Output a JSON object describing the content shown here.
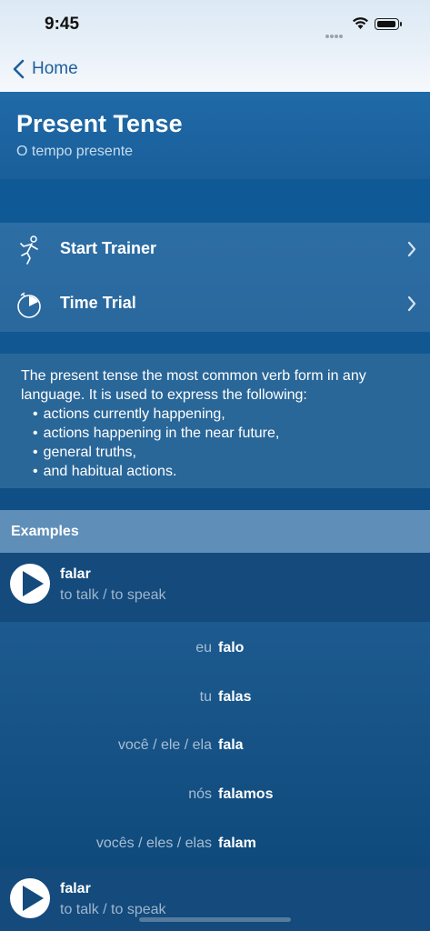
{
  "status": {
    "time": "9:45"
  },
  "nav": {
    "back_label": "Home"
  },
  "header": {
    "title": "Present Tense",
    "subtitle": "O tempo presente"
  },
  "menu": [
    {
      "label": "Start Trainer",
      "icon": "running-figure-icon"
    },
    {
      "label": "Time Trial",
      "icon": "stopwatch-icon"
    }
  ],
  "description": {
    "intro": "The present tense the most common verb form in any language. It is used to express the following:",
    "bullets": [
      "actions currently happening,",
      "actions happening in the near future,",
      "general truths,",
      "and habitual actions."
    ]
  },
  "examples": {
    "header": "Examples",
    "items": [
      {
        "verb": "falar",
        "translation": "to talk / to speak",
        "conjugations": [
          {
            "pronoun": "eu",
            "form": "falo"
          },
          {
            "pronoun": "tu",
            "form": "falas"
          },
          {
            "pronoun": "você / ele / ela",
            "form": "fala"
          },
          {
            "pronoun": "nós",
            "form": "falamos"
          },
          {
            "pronoun": "vocês / eles / elas",
            "form": "falam"
          }
        ]
      },
      {
        "verb": "falar",
        "translation": "to talk / to speak"
      }
    ]
  },
  "colors": {
    "accent": "#1d5f9c",
    "header_bg": "#1f6aa8",
    "examples_header_bg": "#5f8fb8"
  }
}
